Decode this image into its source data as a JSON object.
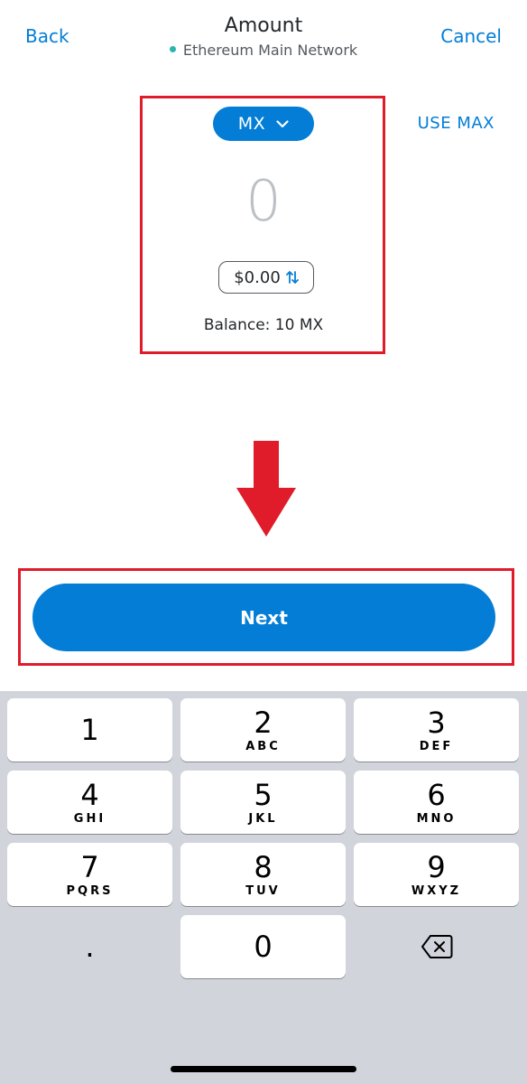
{
  "header": {
    "back_label": "Back",
    "title": "Amount",
    "network": "Ethereum Main Network",
    "cancel_label": "Cancel"
  },
  "amount_panel": {
    "token": "MX",
    "use_max_label": "USE MAX",
    "amount_value": "0",
    "fiat_value": "$0.00",
    "balance": "Balance: 10 MX"
  },
  "next_label": "Next",
  "keyboard": {
    "keys": [
      {
        "num": "1",
        "letters": ""
      },
      {
        "num": "2",
        "letters": "ABC"
      },
      {
        "num": "3",
        "letters": "DEF"
      },
      {
        "num": "4",
        "letters": "GHI"
      },
      {
        "num": "5",
        "letters": "JKL"
      },
      {
        "num": "6",
        "letters": "MNO"
      },
      {
        "num": "7",
        "letters": "PQRS"
      },
      {
        "num": "8",
        "letters": "TUV"
      },
      {
        "num": "9",
        "letters": "WXYZ"
      }
    ],
    "dot": ".",
    "zero": "0"
  },
  "colors": {
    "accent": "#037dd6",
    "highlight": "#e01b2a",
    "network_dot": "#29b6af",
    "keyboard_bg": "#d1d4db"
  }
}
